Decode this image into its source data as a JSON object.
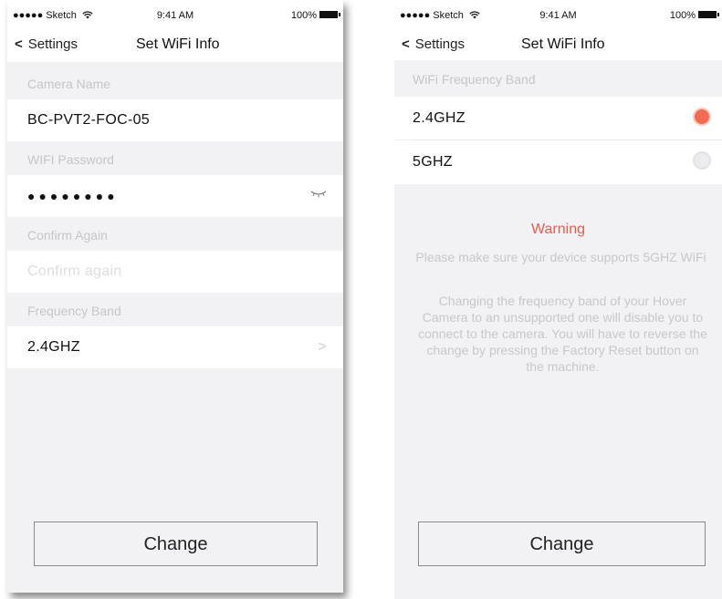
{
  "status_bar": {
    "carrier": "●●●●● Sketch",
    "time": "9:41 AM",
    "battery": "100%"
  },
  "left_screen": {
    "nav": {
      "back_label": "Settings",
      "title": "Set WiFi Info"
    },
    "camera_name": {
      "header": "Camera Name",
      "value": "BC-PVT2-FOC-05"
    },
    "wifi_password": {
      "header": "WIFI Password",
      "value": "●●●●●●●●"
    },
    "confirm": {
      "header": "Confirm Again",
      "placeholder": "Confirm again"
    },
    "frequency": {
      "header": "Frequency Band",
      "value": "2.4GHZ"
    },
    "button_label": "Change"
  },
  "right_screen": {
    "nav": {
      "back_label": "Settings",
      "title": "Set WiFi Info"
    },
    "band_header": "WiFi Frequency Band",
    "options": [
      {
        "label": "2.4GHZ",
        "selected": true
      },
      {
        "label": "5GHZ",
        "selected": false
      }
    ],
    "warning": {
      "title": "Warning",
      "line1": "Please make sure your device supports 5GHZ WiFi",
      "line2": "Changing the frequency band of your Hover Camera to an unsupported one will disable you to connect to the camera. You will have to reverse the change by pressing the Factory Reset button on the machine."
    },
    "button_label": "Change"
  },
  "colors": {
    "accent": "#f06a54",
    "warning": "#e85a4f",
    "muted_text": "#c5c5ca",
    "background": "#f2f2f4"
  },
  "icons": {
    "signal": "signal-dots",
    "wifi": "wifi-icon",
    "battery": "battery-icon",
    "back": "chevron-left-icon",
    "eye": "eye-closed-icon",
    "disclosure": "chevron-right-icon"
  }
}
